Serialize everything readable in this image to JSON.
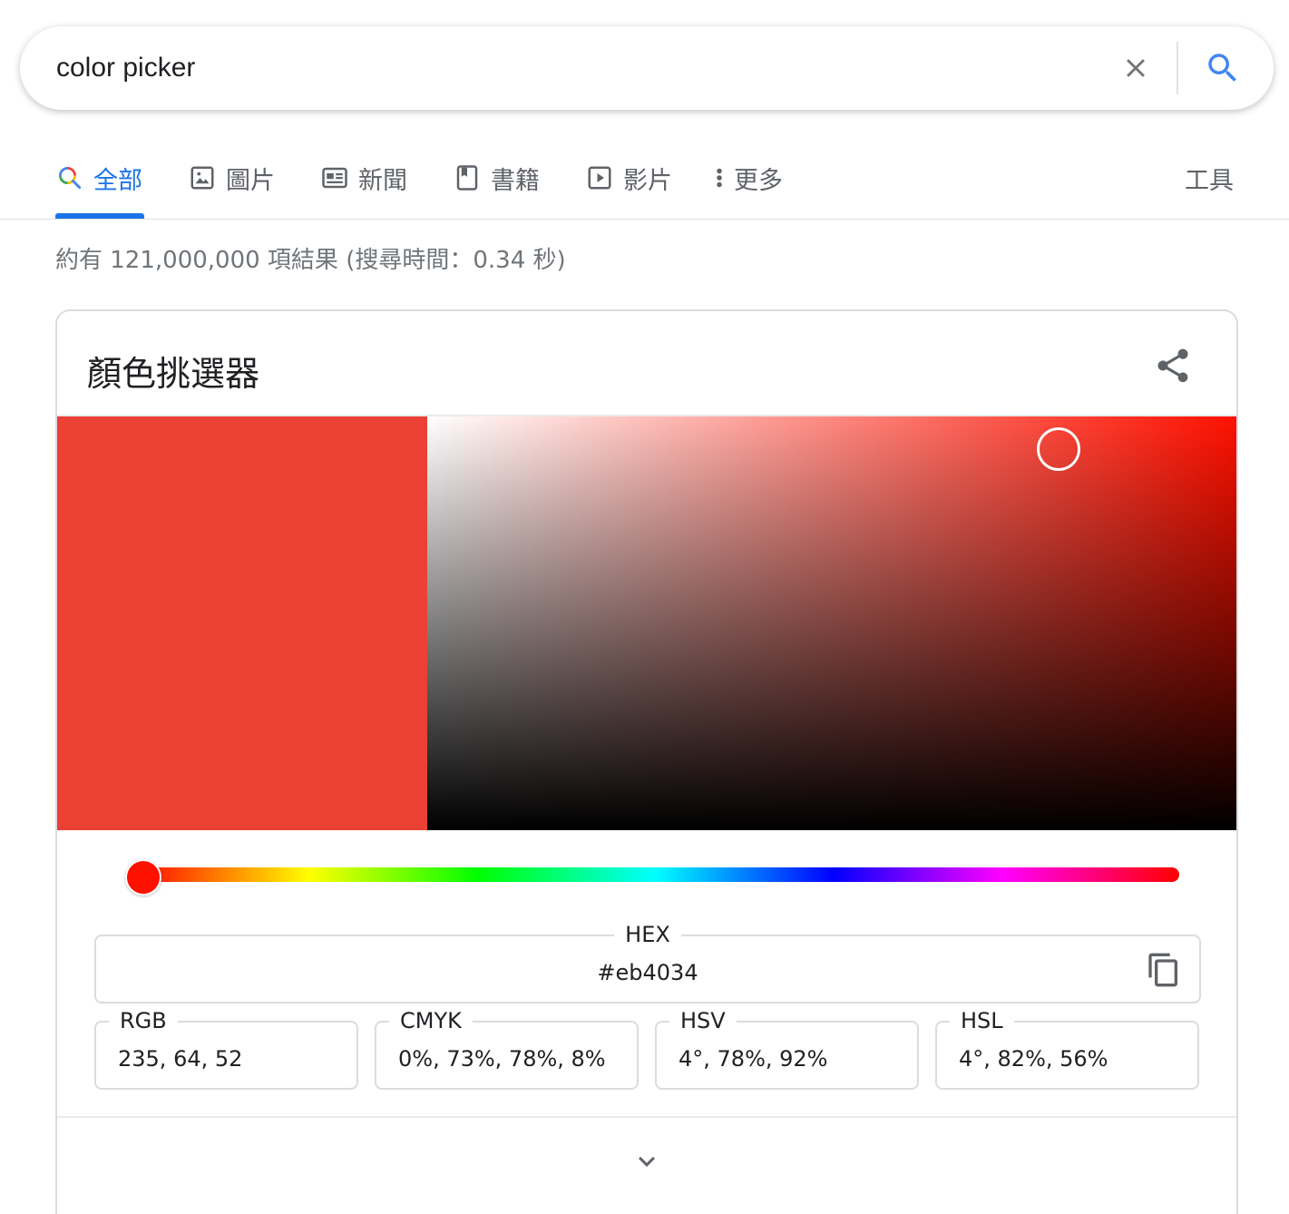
{
  "search": {
    "query": "color picker"
  },
  "tabs": [
    {
      "label": "全部",
      "icon": "search-icon",
      "active": true
    },
    {
      "label": "圖片",
      "icon": "image-icon",
      "active": false
    },
    {
      "label": "新聞",
      "icon": "news-icon",
      "active": false
    },
    {
      "label": "書籍",
      "icon": "book-icon",
      "active": false
    },
    {
      "label": "影片",
      "icon": "video-icon",
      "active": false
    },
    {
      "label": "更多",
      "icon": "more-vert-icon",
      "active": false
    }
  ],
  "tools_label": "工具",
  "result_stats": "約有 121,000,000 項結果 (搜尋時間：0.34 秒)",
  "color_picker": {
    "title": "顏色挑選器",
    "current_color": "#eb4034",
    "hue_color": "#ff1100",
    "hue_degrees": 4,
    "saturation": 0.78,
    "value": 0.92,
    "hex": {
      "label": "HEX",
      "value": "#eb4034"
    },
    "rgb": {
      "label": "RGB",
      "value": "235, 64, 52"
    },
    "cmyk": {
      "label": "CMYK",
      "value": "0%, 73%, 78%, 8%"
    },
    "hsv": {
      "label": "HSV",
      "value": "4°, 78%, 92%"
    },
    "hsl": {
      "label": "HSL",
      "value": "4°, 82%, 56%"
    }
  },
  "colors": {
    "accent": "#1a73e8",
    "text_secondary": "#5f6368",
    "border": "#dadce0"
  }
}
